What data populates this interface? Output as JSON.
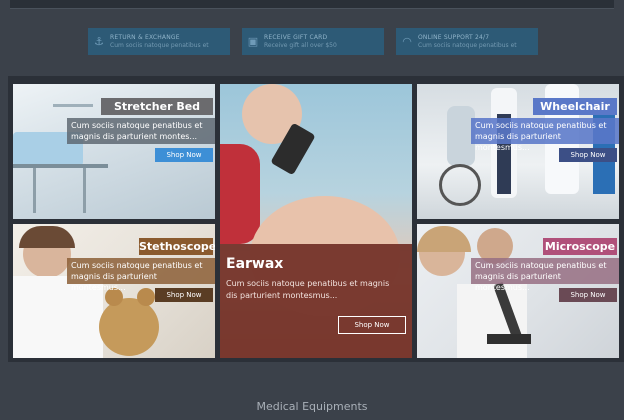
{
  "features": [
    {
      "icon": "anchor-icon",
      "glyph": "⚓",
      "title": "Return & Exchange",
      "subtitle": "Cum sociis natoque penatibus et"
    },
    {
      "icon": "gift-icon",
      "glyph": "🎁",
      "title": "Receive Gift Card",
      "subtitle": "Receive gift all over $50"
    },
    {
      "icon": "wifi-icon",
      "glyph": "📶",
      "title": "Online Support 24/7",
      "subtitle": "Cum sociis natoque penatibus et"
    }
  ],
  "tiles": {
    "stretcher": {
      "title": "Stretcher Bed",
      "description": "Cum sociis natoque penatibus et magnis dis parturient montes...",
      "button": "Shop Now"
    },
    "stethoscope": {
      "title": "Stethoscope",
      "description": "Cum sociis natoque penatibus et magnis dis parturient montesmus...",
      "button": "Shop Now"
    },
    "earwax": {
      "title": "Earwax",
      "description": "Cum sociis natoque penatibus et magnis dis parturient montesmus...",
      "button": "Shop Now"
    },
    "wheelchair": {
      "title": "Wheelchair",
      "description": "Cum sociis natoque penatibus et magnis dis parturient montesmus...",
      "button": "Shop Now"
    },
    "microscope": {
      "title": "Microscope",
      "description": "Cum sociis natoque penatibus et magnis dis parturient montesmus...",
      "button": "Shop Now"
    }
  },
  "colors": {
    "stretcher_tag": "#6b6b6e",
    "stethoscope_tag": "#8a5a2e",
    "earwax_overlay": "#6e2b22",
    "wheelchair_tag": "#5a78c8",
    "microscope_tag": "#b0507a",
    "shop_blue": "#3d8fd6"
  },
  "footer": {
    "title": "Medical Equipments"
  }
}
